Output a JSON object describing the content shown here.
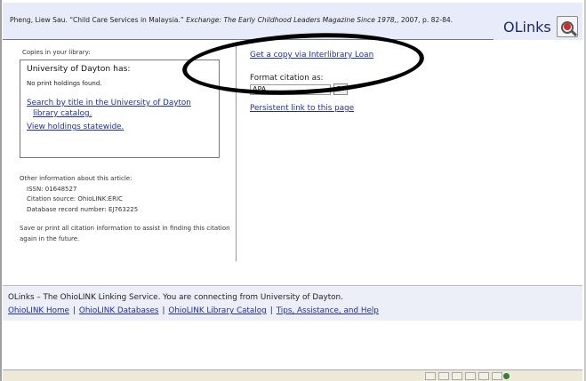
{
  "header": {
    "citation_prefix": "Pheng, Liew Sau. “Child Care Services in Malaysia.”",
    "citation_journal": "Exchange: The Early Childhood Leaders Magazine Since 1978,",
    "citation_suffix": ", 2007, p. 82-84.",
    "logo_text": "OLinks",
    "badge_icon": "findit-magnifier-icon"
  },
  "library": {
    "copies_label": "Copies in your library:",
    "box_title": "University of Dayton has:",
    "no_print": "No print holdings found.",
    "search_link_line1": "Search by title in the University of Dayton",
    "search_link_line2": "library catalog.",
    "statewide_link": "View holdings statewide."
  },
  "article_info": {
    "heading": "Other information about this article:",
    "issn": "ISSN: 01648527",
    "citation_source": "Citation source: OhioLINK:ERIC",
    "record_number": "Database record number: EJ763225"
  },
  "save_note": "Save or print all citation information to assist in finding this citation again in the future.",
  "actions": {
    "ill_link": "Get a copy via Interlibrary Loan",
    "format_label": "Format citation as:",
    "format_selected": "APA",
    "go_label": "Go",
    "persistent_link": "Persistent link to this page"
  },
  "footer": {
    "line1": "OLinks – The OhioLINK Linking Service. You are connecting from University of Dayton.",
    "links": [
      "OhioLINK Home",
      "OhioLINK Databases",
      "OhioLINK Library Catalog",
      "Tips, Assistance, and Help"
    ],
    "separator": "|"
  },
  "colors": {
    "link": "#1f2fa8",
    "header_bg": "#e8ecfa",
    "footer_bg": "#eceef8",
    "annotation_oval": "#000000"
  }
}
